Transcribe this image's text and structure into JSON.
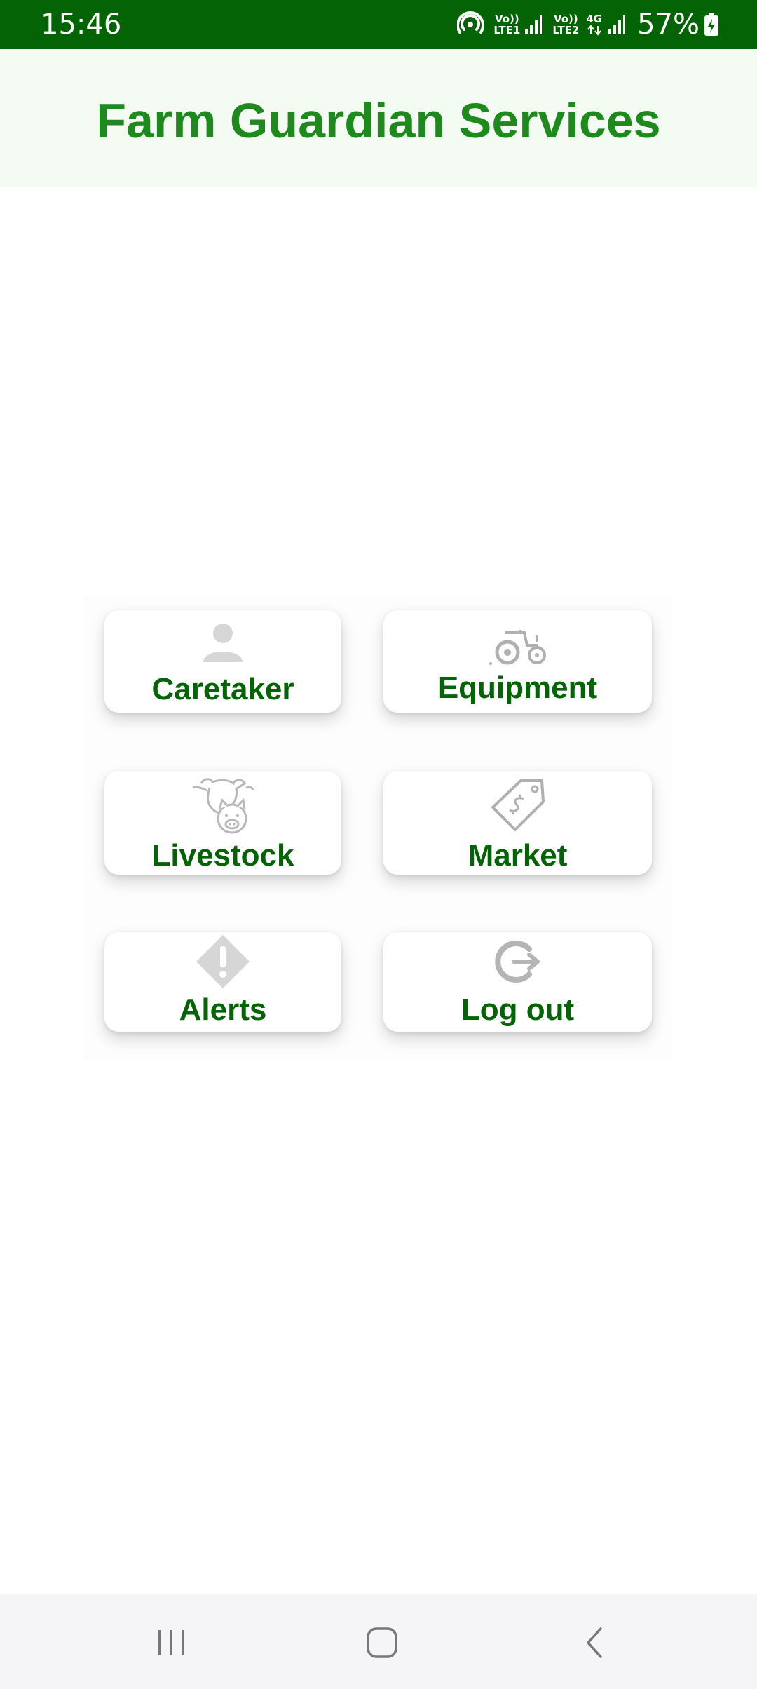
{
  "status_bar": {
    "time": "15:46",
    "sim1_top": "Vo))",
    "sim1_bottom": "LTE1",
    "sim2_top": "Vo))",
    "sim2_bottom": "LTE2",
    "network_type": "4G",
    "battery_percent": "57%",
    "icons": [
      "hotspot-icon",
      "signal-icon",
      "signal-icon",
      "data-arrows-icon",
      "battery-charging-icon"
    ]
  },
  "header": {
    "title": "Farm Guardian Services"
  },
  "menu": {
    "items": [
      {
        "label": "Caretaker",
        "icon": "person-icon"
      },
      {
        "label": "Equipment",
        "icon": "tractor-icon"
      },
      {
        "label": "Livestock",
        "icon": "cow-pig-icon"
      },
      {
        "label": "Market",
        "icon": "price-tag-icon"
      },
      {
        "label": "Alerts",
        "icon": "alert-diamond-icon"
      },
      {
        "label": "Log out",
        "icon": "logout-icon"
      }
    ]
  },
  "nav_bar": {
    "icons": [
      "recent-apps-icon",
      "home-icon",
      "back-icon"
    ]
  },
  "colors": {
    "status_bar": "#046304",
    "title": "#1e8a1e",
    "tile_label": "#046304",
    "header_bg": "#f3fbf3",
    "icon_gray": "#bdbdbd"
  }
}
